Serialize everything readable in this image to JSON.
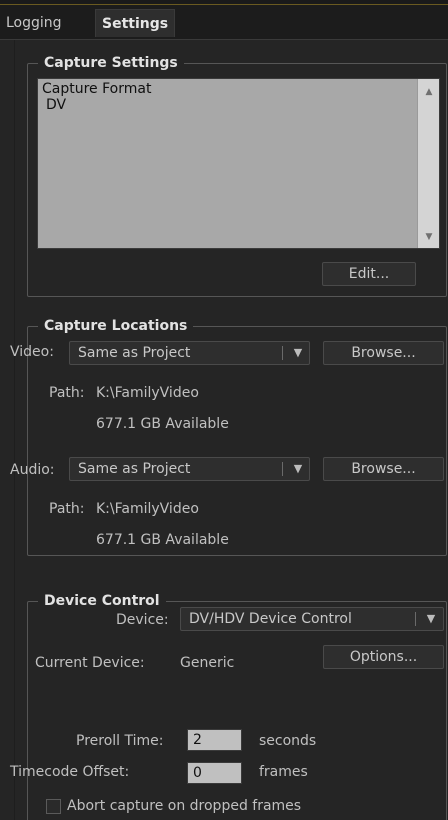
{
  "tabs": [
    {
      "label": "Logging",
      "active": false
    },
    {
      "label": "Settings",
      "active": true
    }
  ],
  "capture_settings": {
    "title": "Capture Settings",
    "format_label": "Capture Format",
    "format_value": "DV",
    "edit_label": "Edit..."
  },
  "capture_locations": {
    "title": "Capture Locations",
    "video": {
      "label": "Video:",
      "selected": "Same as Project",
      "browse_label": "Browse...",
      "path_label": "Path:",
      "path": "K:\\FamilyVideo",
      "available": "677.1 GB Available"
    },
    "audio": {
      "label": "Audio:",
      "selected": "Same as Project",
      "browse_label": "Browse...",
      "path_label": "Path:",
      "path": "K:\\FamilyVideo",
      "available": "677.1 GB Available"
    }
  },
  "device_control": {
    "title": "Device Control",
    "device_label": "Device:",
    "device_selected": "DV/HDV Device Control",
    "options_label": "Options...",
    "current_device_label": "Current Device:",
    "current_device": "Generic",
    "preroll_label": "Preroll Time:",
    "preroll_value": "2",
    "preroll_unit": "seconds",
    "timecode_label": "Timecode Offset:",
    "timecode_value": "0",
    "timecode_unit": "frames",
    "abort_label": "Abort capture on dropped frames",
    "abort_checked": false
  },
  "colors": {
    "background": "#252525",
    "listbox": "#a8a8a8",
    "accent_line": "#6a5a20"
  }
}
